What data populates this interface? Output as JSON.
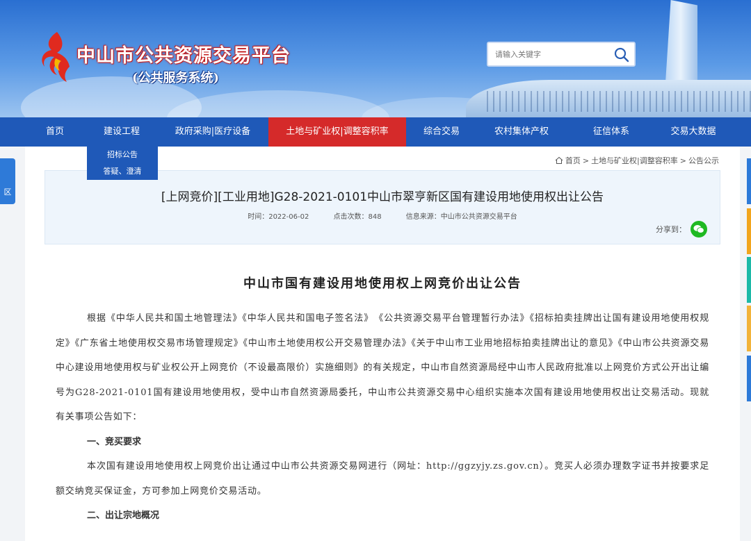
{
  "header": {
    "title": "中山市公共资源交易平台",
    "subtitle": "(公共服务系统)",
    "search_placeholder": "请输入关键字"
  },
  "nav": {
    "items": [
      {
        "label": "首页",
        "active": false
      },
      {
        "label": "建设工程",
        "active": false
      },
      {
        "label": "政府采购|医疗设备",
        "active": false
      },
      {
        "label": "土地与矿业权|调整容积率",
        "active": true
      },
      {
        "label": "综合交易",
        "active": false
      },
      {
        "label": "农村集体产权",
        "active": false
      },
      {
        "label": "征信体系",
        "active": false
      },
      {
        "label": "交易大数据",
        "active": false
      }
    ],
    "dropdown": [
      "招标公告",
      "答疑、澄清"
    ]
  },
  "side": {
    "left_tab": "区"
  },
  "breadcrumb": {
    "home": "首页",
    "sep1": ">",
    "level1": "土地与矿业权|调整容积率",
    "sep2": ">",
    "level2": "公告公示"
  },
  "notice": {
    "title": "[上网竞价][工业用地]G28-2021-0101中山市翠亨新区国有建设用地使用权出让公告",
    "time": "时间：2022-06-02",
    "clicks": "点击次数：848",
    "source": "信息来源：中山市公共资源交易平台",
    "share_label": "分享到："
  },
  "document": {
    "title": "中山市国有建设用地使用权上网竞价出让公告",
    "intro": "根据《中华人民共和国土地管理法》《中华人民共和国电子签名法》　《公共资源交易平台管理暂行办法》《招标拍卖挂牌出让国有建设用地使用权规定》《广东省土地使用权交易市场管理规定》《中山市土地使用权公开交易管理办法》《关于中山市工业用地招标拍卖挂牌出让的意见》《中山市公共资源交易中心建设用地使用权与矿业权公开上网竞价（不设最高限价）实施细则》的有关规定，中山市自然资源局经中山市人民政府批准以上网竞价方式公开出让编号为G28-2021-0101国有建设用地使用权，受中山市自然资源局委托，中山市公共资源交易中心组织实施本次国有建设用地使用权出让交易活动。现就有关事项公告如下：",
    "section1_heading": "一、竞买要求",
    "section1_text": "本次国有建设用地使用权上网竞价出让通过中山市公共资源交易网进行（网址：http://ggzyjy.zs.gov.cn）。竞买人必须办理数字证书并按要求足额交纳竞买保证金，方可参加上网竞价交易活动。",
    "section2_heading": "二、出让宗地概况"
  },
  "colors": {
    "nav_bg": "#1f59b8",
    "nav_active": "#d52a2a",
    "wechat": "#1fb922",
    "title_box_bg": "#eef5fc"
  }
}
